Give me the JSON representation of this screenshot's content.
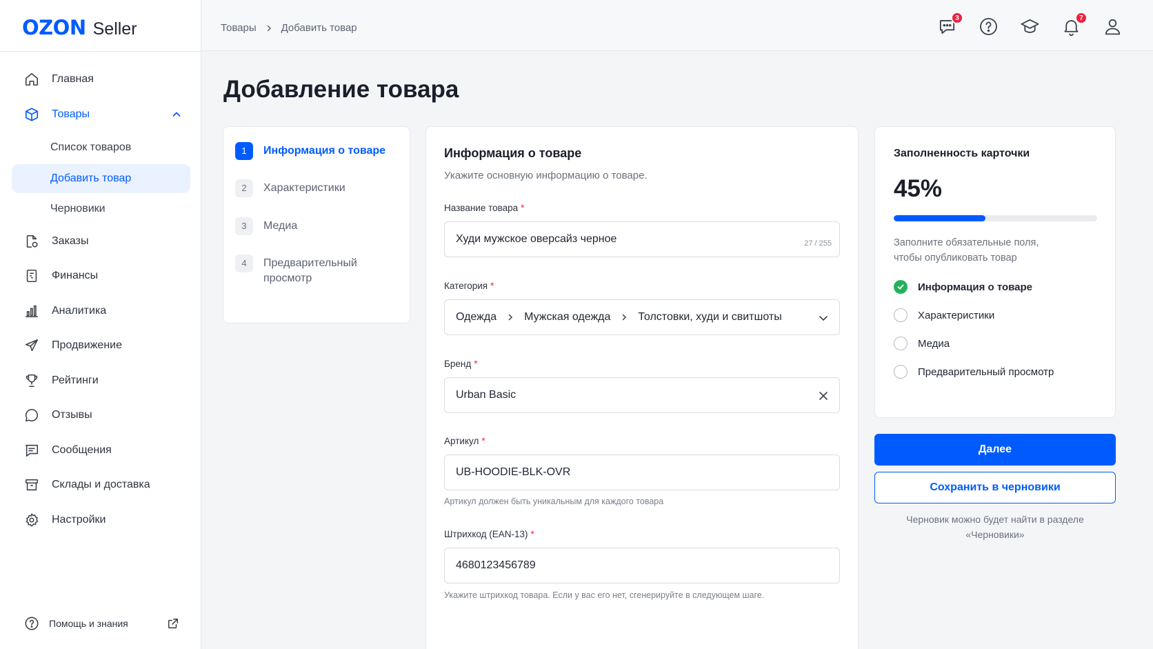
{
  "app": {
    "logo_brand": "OZON",
    "logo_product": "Seller"
  },
  "breadcrumbs": [
    "Товары",
    "Добавить товар"
  ],
  "header": {
    "icons": [
      {
        "name": "chat-icon",
        "badge": "3"
      },
      {
        "name": "help-icon",
        "badge": null
      },
      {
        "name": "education-icon",
        "badge": null
      },
      {
        "name": "notifications-icon",
        "badge": "7"
      },
      {
        "name": "profile-icon",
        "badge": null
      }
    ]
  },
  "sidebar": {
    "items": [
      {
        "label": "Главная",
        "icon": "home-icon"
      },
      {
        "label": "Товары",
        "icon": "box-icon",
        "active": true,
        "expanded": true
      },
      {
        "label": "Заказы",
        "icon": "orders-icon"
      },
      {
        "label": "Финансы",
        "icon": "finance-icon"
      },
      {
        "label": "Аналитика",
        "icon": "analytics-icon"
      },
      {
        "label": "Продвижение",
        "icon": "promotion-icon"
      },
      {
        "label": "Рейтинги",
        "icon": "trophy-icon"
      },
      {
        "label": "Отзывы",
        "icon": "reviews-icon"
      },
      {
        "label": "Сообщения",
        "icon": "messages-icon"
      },
      {
        "label": "Склады и доставка",
        "icon": "warehouse-icon"
      },
      {
        "label": "Настройки",
        "icon": "settings-icon"
      }
    ],
    "sub_items": [
      {
        "label": "Список товаров"
      },
      {
        "label": "Добавить товар",
        "active": true
      },
      {
        "label": "Черновики"
      }
    ],
    "help_label": "Помощь и знания"
  },
  "page": {
    "title": "Добавление товара"
  },
  "steps": [
    {
      "num": "1",
      "label": "Информация о товаре",
      "active": true
    },
    {
      "num": "2",
      "label": "Характеристики"
    },
    {
      "num": "3",
      "label": "Медиа"
    },
    {
      "num": "4",
      "label": "Предварительный просмотр"
    }
  ],
  "form": {
    "title": "Информация о товаре",
    "subtitle": "Укажите основную информацию о товаре.",
    "name": {
      "label": "Название товара",
      "value": "Худи мужское оверсайз черное",
      "counter": "27 / 255"
    },
    "category": {
      "label": "Категория",
      "path": [
        "Одежда",
        "Мужская одежда",
        "Толстовки, худи и свитшоты"
      ]
    },
    "brand": {
      "label": "Бренд",
      "value": "Urban Basic"
    },
    "sku": {
      "label": "Артикул",
      "value": "UB-HOODIE-BLK-OVR",
      "hint": "Артикул должен быть уникальным для каждого товара"
    },
    "barcode": {
      "label": "Штрихкод (EAN-13)",
      "value": "4680123456789",
      "hint": "Укажите штрихкод товара. Если у вас его нет, сгенерируйте в следующем шаге."
    }
  },
  "fill": {
    "title": "Заполненность карточки",
    "percent_label": "45%",
    "percent": 45,
    "description": "Заполните обязательные поля, чтобы опубликовать товар",
    "checklist": [
      {
        "label": "Информация о товаре",
        "done": true
      },
      {
        "label": "Характеристики",
        "done": false
      },
      {
        "label": "Медиа",
        "done": false
      },
      {
        "label": "Предварительный просмотр",
        "done": false
      }
    ]
  },
  "actions": {
    "next_label": "Далее",
    "save_draft_label": "Сохранить в черновики",
    "draft_note": "Черновик можно будет найти в разделе «Черновики»"
  },
  "colors": {
    "accent": "#005bff",
    "success": "#23b15a",
    "badge": "#f1213d"
  }
}
